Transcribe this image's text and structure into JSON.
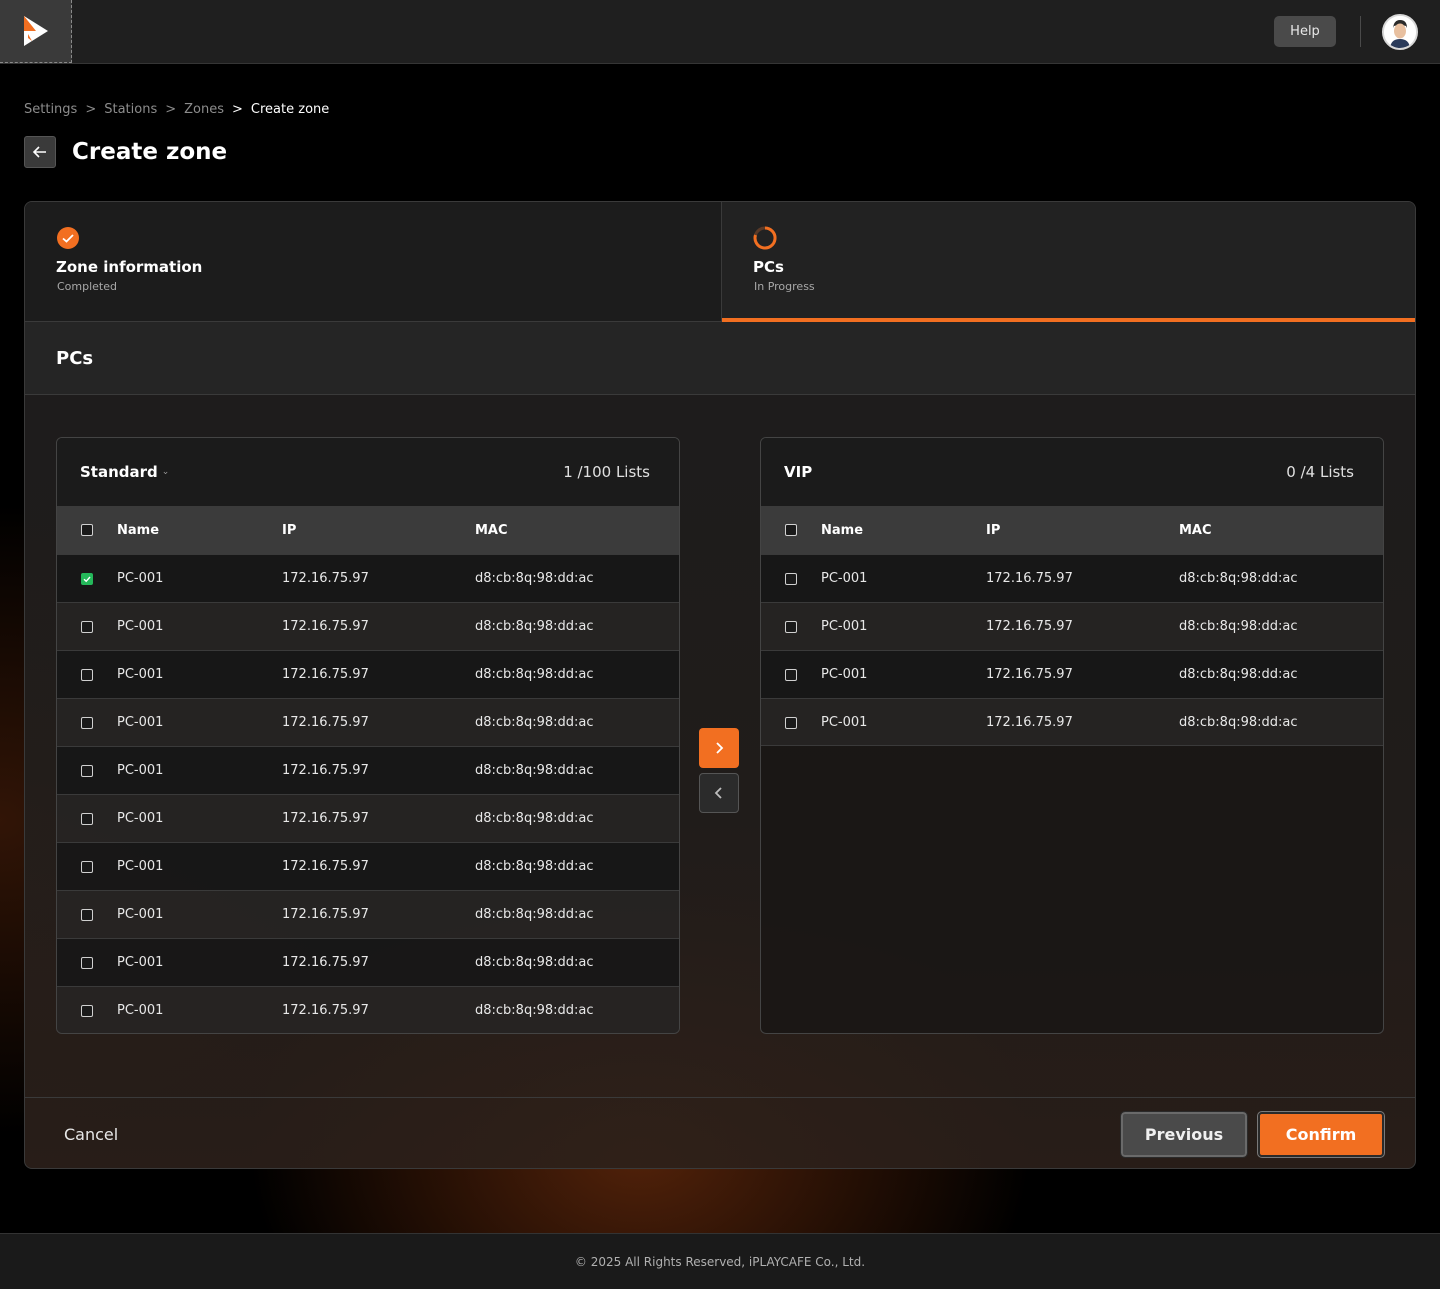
{
  "header": {
    "logo_icon": "play-logo-icon",
    "help_label": "Help",
    "avatar_icon": "user-avatar"
  },
  "breadcrumb": {
    "items": [
      "Settings",
      "Stations",
      "Zones"
    ],
    "separator": ">",
    "current": "Create zone"
  },
  "page": {
    "back_icon": "arrow-left-icon",
    "title": "Create zone"
  },
  "steps": [
    {
      "title": "Zone information",
      "status": "Completed",
      "icon": "check-circle-icon"
    },
    {
      "title": "PCs",
      "status": "In Progress",
      "icon": "progress-ring-icon"
    }
  ],
  "section": {
    "title": "PCs"
  },
  "columns": {
    "name": "Name",
    "ip": "IP",
    "mac": "MAC"
  },
  "standard": {
    "title": "Standard",
    "count": "1 /100 Lists",
    "rows": [
      {
        "name": "PC-001",
        "ip": "172.16.75.97",
        "mac": "d8:cb:8q:98:dd:ac",
        "checked": true
      },
      {
        "name": "PC-001",
        "ip": "172.16.75.97",
        "mac": "d8:cb:8q:98:dd:ac",
        "checked": false
      },
      {
        "name": "PC-001",
        "ip": "172.16.75.97",
        "mac": "d8:cb:8q:98:dd:ac",
        "checked": false
      },
      {
        "name": "PC-001",
        "ip": "172.16.75.97",
        "mac": "d8:cb:8q:98:dd:ac",
        "checked": false
      },
      {
        "name": "PC-001",
        "ip": "172.16.75.97",
        "mac": "d8:cb:8q:98:dd:ac",
        "checked": false
      },
      {
        "name": "PC-001",
        "ip": "172.16.75.97",
        "mac": "d8:cb:8q:98:dd:ac",
        "checked": false
      },
      {
        "name": "PC-001",
        "ip": "172.16.75.97",
        "mac": "d8:cb:8q:98:dd:ac",
        "checked": false
      },
      {
        "name": "PC-001",
        "ip": "172.16.75.97",
        "mac": "d8:cb:8q:98:dd:ac",
        "checked": false
      },
      {
        "name": "PC-001",
        "ip": "172.16.75.97",
        "mac": "d8:cb:8q:98:dd:ac",
        "checked": false
      },
      {
        "name": "PC-001",
        "ip": "172.16.75.97",
        "mac": "d8:cb:8q:98:dd:ac",
        "checked": false
      }
    ]
  },
  "vip": {
    "title": "VIP",
    "count": "0 /4 Lists",
    "rows": [
      {
        "name": "PC-001",
        "ip": "172.16.75.97",
        "mac": "d8:cb:8q:98:dd:ac",
        "checked": false
      },
      {
        "name": "PC-001",
        "ip": "172.16.75.97",
        "mac": "d8:cb:8q:98:dd:ac",
        "checked": false
      },
      {
        "name": "PC-001",
        "ip": "172.16.75.97",
        "mac": "d8:cb:8q:98:dd:ac",
        "checked": false
      },
      {
        "name": "PC-001",
        "ip": "172.16.75.97",
        "mac": "d8:cb:8q:98:dd:ac",
        "checked": false
      }
    ]
  },
  "transfer": {
    "right_icon": "chevron-right-icon",
    "left_icon": "chevron-left-icon"
  },
  "footer_actions": {
    "cancel": "Cancel",
    "previous": "Previous",
    "confirm": "Confirm"
  },
  "copyright": "© 2025 All Rights Reserved, iPLAYCAFE Co., Ltd.",
  "colors": {
    "accent": "#f26f21",
    "check": "#24b85a"
  }
}
